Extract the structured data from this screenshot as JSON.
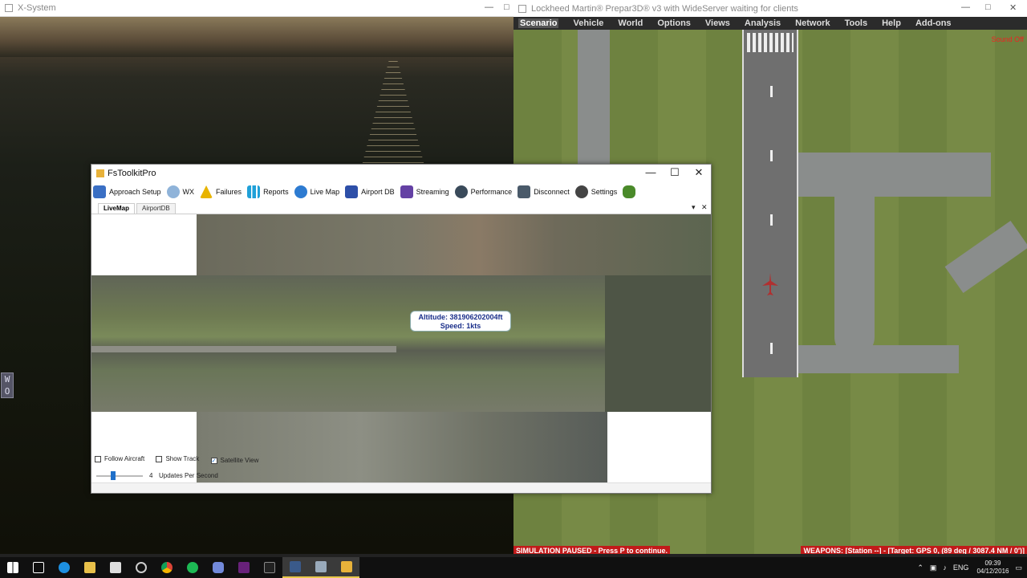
{
  "xsystem": {
    "title": "X-System",
    "controls": [
      "—",
      "□"
    ]
  },
  "p3d": {
    "title": "Lockheed Martin® Prepar3D® v3 with WideServer waiting for clients",
    "controls": [
      "—",
      "□",
      "✕"
    ],
    "menu": [
      "Scenario",
      "Vehicle",
      "World",
      "Options",
      "Views",
      "Analysis",
      "Network",
      "Tools",
      "Help",
      "Add-ons"
    ],
    "sound_off": "Sound Off",
    "sim_paused": "SIMULATION PAUSED - Press P to continue.",
    "weapons": "WEAPONS: [Station --] - [Target: GPS 0, (89 deg / 3087.4 NM / 0')]"
  },
  "wo_indicator": [
    "W",
    "O"
  ],
  "fstk": {
    "title": "FsToolkitPro",
    "controls": [
      "—",
      "☐",
      "✕"
    ],
    "toolbar": [
      {
        "label": "Approach Setup",
        "icon": "approach-icon",
        "color": "#3a6fc4"
      },
      {
        "label": "WX",
        "icon": "cloud-icon",
        "color": "#8fb3d9"
      },
      {
        "label": "Failures",
        "icon": "warning-icon",
        "color": "#e8b400"
      },
      {
        "label": "Reports",
        "icon": "bar-chart-icon",
        "color": "#1fa0d8"
      },
      {
        "label": "Live Map",
        "icon": "compass-icon",
        "color": "#2d7bd1"
      },
      {
        "label": "Airport DB",
        "icon": "airport-icon",
        "color": "#2d4fa8"
      },
      {
        "label": "Streaming",
        "icon": "twitch-icon",
        "color": "#6441a4"
      },
      {
        "label": "Performance",
        "icon": "gauge-icon",
        "color": "#3a4a5a"
      },
      {
        "label": "Disconnect",
        "icon": "plug-icon",
        "color": "#4a5a6a"
      },
      {
        "label": "Settings",
        "icon": "gear-icon",
        "color": "#444"
      },
      {
        "label": "",
        "icon": "bug-icon",
        "color": "#4a8a2a"
      }
    ],
    "tabs": [
      "LiveMap",
      "AirportDB"
    ],
    "tooltip": {
      "altitude": "Altitude: 381906202004ft",
      "speed": "Speed: 1kts"
    },
    "options": [
      {
        "label": "Follow Aircraft",
        "checked": false
      },
      {
        "label": "Show Track",
        "checked": false
      },
      {
        "label": "Satellite View",
        "checked": true
      }
    ],
    "updates_value": "4",
    "updates_label": "Updates Per Second"
  },
  "taskbar": {
    "apps": [
      "start-icon",
      "task-view-icon",
      "edge-icon",
      "file-explorer-icon",
      "store-icon",
      "app-icon",
      "chrome-icon",
      "spotify-icon",
      "discord-icon",
      "visual-studio-icon",
      "terminal-icon",
      "p3d-icon",
      "explorer-icon",
      "fstk-icon"
    ],
    "lang": "ENG",
    "time": "09:39",
    "date": "04/12/2016"
  }
}
